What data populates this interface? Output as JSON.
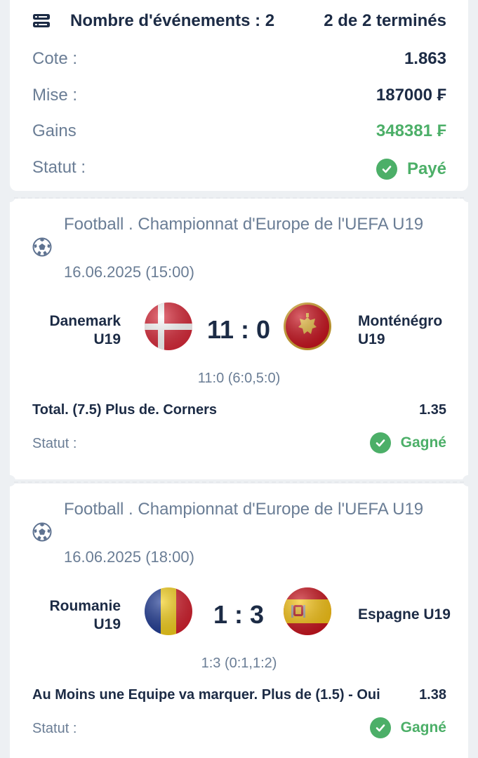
{
  "summary": {
    "events_label": "Nombre d'événements : 2",
    "finished_label": "2 de 2 terminés",
    "rows": [
      {
        "label": "Cote :",
        "value": "1.863"
      },
      {
        "label": "Mise :",
        "value": "187000 ₣"
      },
      {
        "label": "Gains",
        "value": "348381 ₣"
      }
    ],
    "status_label": "Statut :",
    "status_value": "Payé",
    "accent_green": "#4caf68"
  },
  "events": [
    {
      "competition": "Football . Championnat d'Europe de l'UEFA U19",
      "date": "16.06.2025 (15:00)",
      "home": {
        "name": "Danemark U19",
        "flag": "denmark-flag"
      },
      "away": {
        "name": "Monténégro U19",
        "flag": "montenegro-flag"
      },
      "score": "11 : 0",
      "score_detail": "11:0 (6:0,5:0)",
      "bet": "Total. (7.5) Plus de. Corners",
      "odd": "1.35",
      "status_label": "Statut :",
      "status_value": "Gagné"
    },
    {
      "competition": "Football . Championnat d'Europe de l'UEFA U19",
      "date": "16.06.2025 (18:00)",
      "home": {
        "name": "Roumanie U19",
        "flag": "romania-flag"
      },
      "away": {
        "name": "Espagne U19",
        "flag": "spain-flag"
      },
      "score": "1 : 3",
      "score_detail": "1:3 (0:1,1:2)",
      "bet": "Au Moins une Equipe va marquer. Plus de (1.5) - Oui",
      "odd": "1.38",
      "status_label": "Statut :",
      "status_value": "Gagné"
    }
  ]
}
